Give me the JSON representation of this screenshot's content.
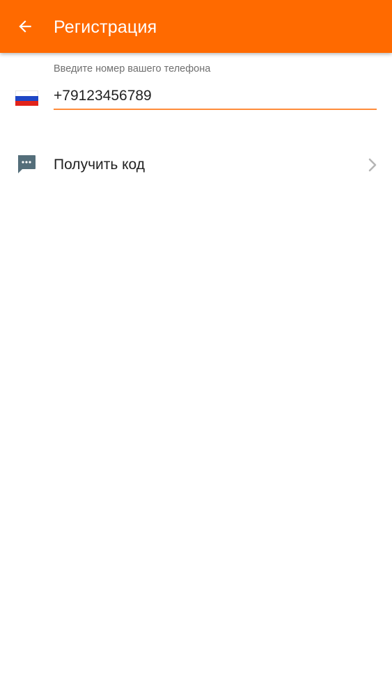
{
  "colors": {
    "app_bar": "#ff6a00",
    "accent_underline": "#ff8c3a",
    "icon_gray": "#546e7a",
    "flag_white": "#ffffff",
    "flag_blue": "#1f47c6",
    "flag_red": "#e2231a"
  },
  "header": {
    "back_icon": "arrow-left-icon",
    "title": "Регистрация"
  },
  "phone": {
    "label": "Введите номер вашего телефона",
    "value": "+79123456789",
    "country_flag": "russia-flag-icon"
  },
  "get_code": {
    "icon": "message-icon",
    "label": "Получить код",
    "chevron_icon": "chevron-right-icon"
  }
}
